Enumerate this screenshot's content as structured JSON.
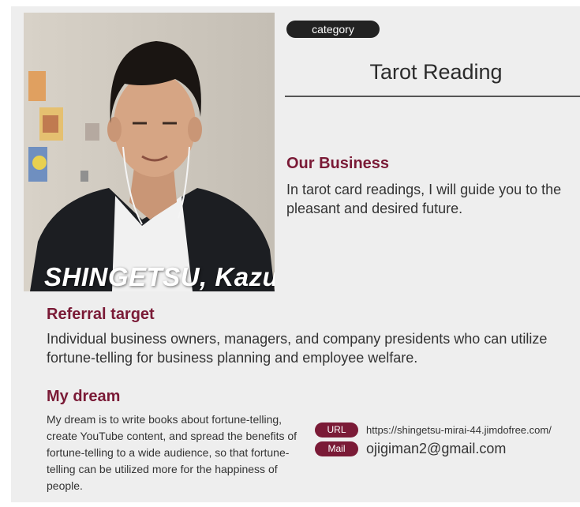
{
  "profile": {
    "name": "SHINGETSU, Kazu",
    "category_label": "category",
    "category": "Tarot Reading"
  },
  "business": {
    "heading": "Our Business",
    "text": "In tarot card readings, I will guide you to the pleasant and desired future."
  },
  "referral": {
    "heading": "Referral target",
    "text": "Individual business owners, managers, and company presidents who can utilize fortune-telling for business planning and employee welfare."
  },
  "dream": {
    "heading": "My dream",
    "text": "My dream is to write books about fortune-telling, create YouTube content, and spread the benefits of fortune-telling to a wide audience, so that fortune-telling can be utilized more for the happiness of people."
  },
  "contact": {
    "url_label": "URL",
    "url": "https://shingetsu-mirai-44.jimdofree.com/",
    "mail_label": "Mail",
    "mail": "ojigiman2@gmail.com"
  },
  "colors": {
    "accent": "#7a1a36",
    "badge": "#222222",
    "card_background": "#eeeeee"
  }
}
